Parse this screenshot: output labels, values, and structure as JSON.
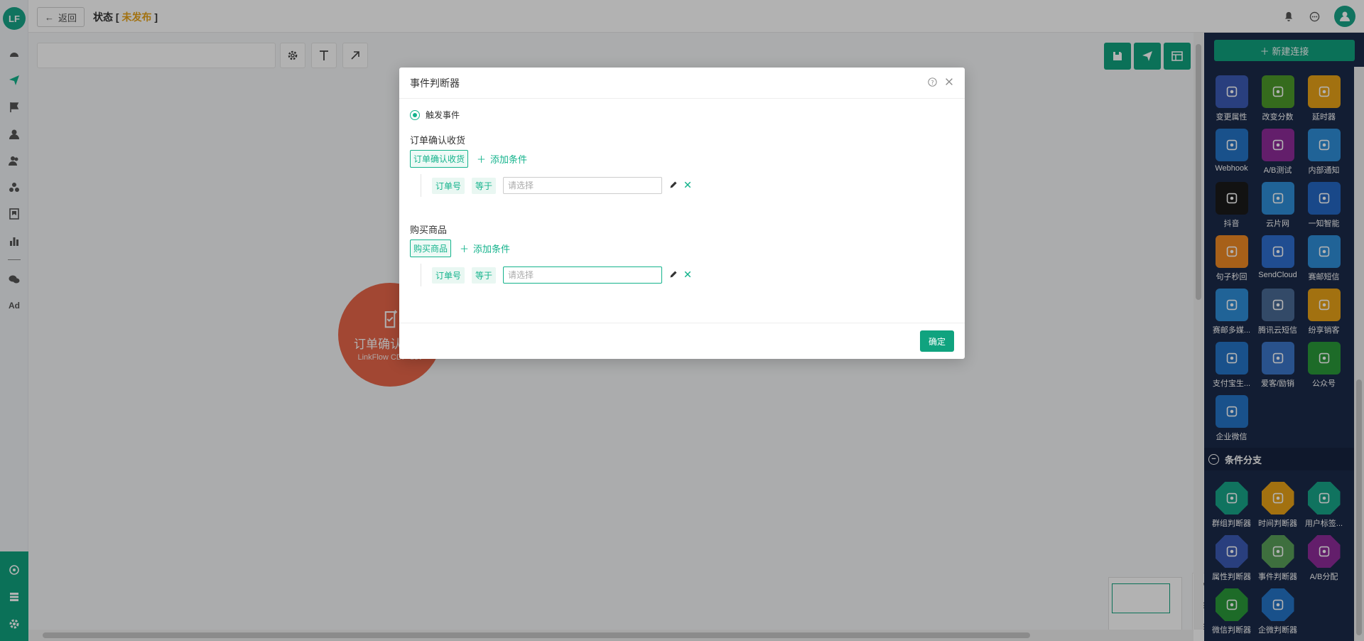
{
  "header": {
    "back_label": "返回",
    "status_prefix": "状态 [",
    "status_value": "未发布",
    "status_suffix": "]"
  },
  "logo": {
    "text": "LF"
  },
  "nav": {
    "ad_label": "Ad"
  },
  "canvas": {
    "node": {
      "title": "订单确认收货",
      "subtitle": "LinkFlow CDP-dev",
      "color": "#e8664a"
    }
  },
  "panel": {
    "new_connection": "新建连接",
    "items": [
      {
        "label": "变更属性",
        "icon": "edit-icon",
        "color": "#3b5bb5"
      },
      {
        "label": "改变分数",
        "icon": "trophy-icon",
        "color": "#4c9a2a"
      },
      {
        "label": "延时器",
        "icon": "hourglass-icon",
        "color": "#e8a317"
      },
      {
        "label": "Webhook",
        "icon": "webhook-icon",
        "color": "#2474c7"
      },
      {
        "label": "A/B测试",
        "icon": "ab-test-icon",
        "color": "#8e2c9a"
      },
      {
        "label": "内部通知",
        "icon": "bell-icon",
        "color": "#2f8fd8"
      },
      {
        "label": "抖音",
        "icon": "douyin-icon",
        "color": "#1a1a1a"
      },
      {
        "label": "云片网",
        "icon": "cloud-icon",
        "color": "#2f8fd8"
      },
      {
        "label": "一知智能",
        "icon": "yizhi-icon",
        "color": "#2468c4"
      },
      {
        "label": "句子秒回",
        "icon": "chat-pin-icon",
        "color": "#f08a24"
      },
      {
        "label": "SendCloud",
        "icon": "sendcloud-icon",
        "color": "#2f6fd0"
      },
      {
        "label": "赛邮短信",
        "icon": "submail-icon",
        "color": "#2f8fd8"
      },
      {
        "label": "赛邮多媒...",
        "icon": "submail-media-icon",
        "color": "#2f8fd8"
      },
      {
        "label": "腾讯云短信",
        "icon": "tencent-cloud-icon",
        "color": "#4a6a95"
      },
      {
        "label": "纷享销客",
        "icon": "fxiaoke-icon",
        "color": "#e8a317"
      },
      {
        "label": "支付宝生...",
        "icon": "alipay-icon",
        "color": "#2474c7"
      },
      {
        "label": "爱客/励销",
        "icon": "aike-icon",
        "color": "#3b76c9"
      },
      {
        "label": "公众号",
        "icon": "wechat-icon",
        "color": "#2a9a3a"
      },
      {
        "label": "企业微信",
        "icon": "wecom-icon",
        "color": "#2474c7"
      }
    ],
    "section_title": "条件分支",
    "branch_items": [
      {
        "label": "群组判断器",
        "icon": "group-judge-icon",
        "color": "#17a589"
      },
      {
        "label": "时间判断器",
        "icon": "time-judge-icon",
        "color": "#e8a317"
      },
      {
        "label": "用户标签...",
        "icon": "user-tag-icon",
        "color": "#17a589"
      },
      {
        "label": "属性判断器",
        "icon": "attr-judge-icon",
        "color": "#3b5bb5"
      },
      {
        "label": "事件判断器",
        "icon": "event-judge-icon",
        "color": "#5aa05a"
      },
      {
        "label": "A/B分配",
        "icon": "ab-split-icon",
        "color": "#8e2c9a"
      },
      {
        "label": "微信判断器",
        "icon": "wechat-judge-icon",
        "color": "#2a9a3a"
      },
      {
        "label": "企微判断器",
        "icon": "wecom-judge-icon",
        "color": "#2474c7"
      }
    ]
  },
  "modal": {
    "title": "事件判断器",
    "radio_label": "触发事件",
    "groups": [
      {
        "title": "订单确认收货",
        "tag": "订单确认收货",
        "add_label": "添加条件",
        "condition": {
          "field": "订单号",
          "operator": "等于",
          "placeholder": "请选择"
        }
      },
      {
        "title": "购买商品",
        "tag": "购买商品",
        "add_label": "添加条件",
        "condition": {
          "field": "订单号",
          "operator": "等于",
          "placeholder": "请选择"
        }
      }
    ],
    "ok_label": "确定"
  },
  "colors": {
    "accent": "#10a37f",
    "warning": "#e8a317",
    "panel_bg": "#1b2a4a"
  }
}
